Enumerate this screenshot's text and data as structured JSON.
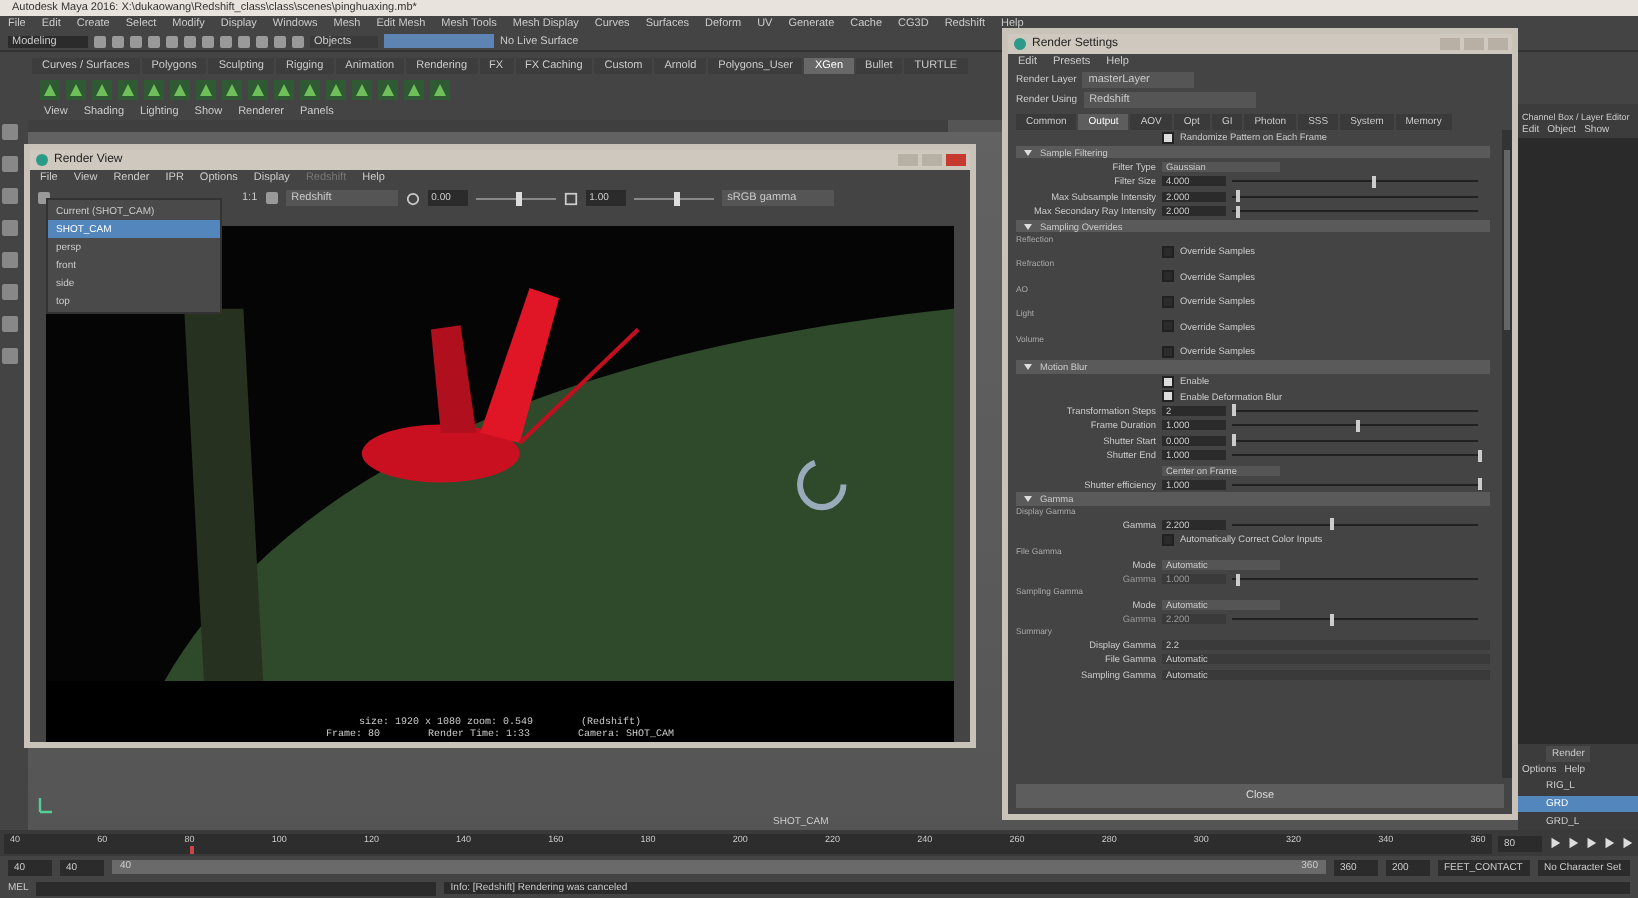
{
  "app": {
    "title": "Autodesk Maya 2016: X:\\dukaowang\\Redshift_class\\class\\scenes\\pinghuaxing.mb*"
  },
  "main_menu": [
    "File",
    "Edit",
    "Create",
    "Select",
    "Modify",
    "Display",
    "Windows",
    "Mesh",
    "Edit Mesh",
    "Mesh Tools",
    "Mesh Display",
    "Curves",
    "Surfaces",
    "Deform",
    "UV",
    "Generate",
    "Cache",
    "CG3D",
    "Redshift",
    "Help"
  ],
  "status_line": {
    "mode": "Modeling",
    "selection": "Objects",
    "live_surface": "No Live Surface"
  },
  "shelf": {
    "tabs": [
      {
        "label": "Curves / Surfaces",
        "selected": false
      },
      {
        "label": "Polygons",
        "selected": false
      },
      {
        "label": "Sculpting",
        "selected": false
      },
      {
        "label": "Rigging",
        "selected": false
      },
      {
        "label": "Animation",
        "selected": false
      },
      {
        "label": "Rendering",
        "selected": false
      },
      {
        "label": "FX",
        "selected": false
      },
      {
        "label": "FX Caching",
        "selected": false
      },
      {
        "label": "Custom",
        "selected": false
      },
      {
        "label": "Arnold",
        "selected": false
      },
      {
        "label": "Polygons_User",
        "selected": false
      },
      {
        "label": "XGen",
        "selected": true
      },
      {
        "label": "Bullet",
        "selected": false
      },
      {
        "label": "TURTLE",
        "selected": false
      }
    ]
  },
  "panel_menu": [
    "View",
    "Shading",
    "Lighting",
    "Show",
    "Renderer",
    "Panels"
  ],
  "viewport": {
    "camera_label": "SHOT_CAM"
  },
  "render_view": {
    "title": "Render View",
    "menu": [
      {
        "label": "File",
        "disabled": false
      },
      {
        "label": "View",
        "disabled": false
      },
      {
        "label": "Render",
        "disabled": false
      },
      {
        "label": "IPR",
        "disabled": false
      },
      {
        "label": "Options",
        "disabled": false
      },
      {
        "label": "Display",
        "disabled": false
      },
      {
        "label": "Redshift",
        "disabled": true
      },
      {
        "label": "Help",
        "disabled": false
      }
    ],
    "ratio": "1:1",
    "renderer": "Redshift",
    "exposure": "0.00",
    "exposure_slider": {
      "level": 0.5
    },
    "gamma": "1.00",
    "gamma_slider": {
      "level": 0.5
    },
    "color_space": "sRGB gamma",
    "camera_menu": [
      {
        "label": "Current (SHOT_CAM)",
        "selected": false
      },
      {
        "label": "SHOT_CAM",
        "selected": true
      },
      {
        "label": "persp",
        "selected": false
      },
      {
        "label": "front",
        "selected": false
      },
      {
        "label": "side",
        "selected": false
      },
      {
        "label": "top",
        "selected": false
      }
    ],
    "info_top": [
      "size: 1920 x 1080 zoom: 0.549",
      "(Redshift)"
    ],
    "info_bottom": [
      "Frame: 80",
      "Render Time: 1:33",
      "Camera: SHOT_CAM"
    ]
  },
  "render_settings": {
    "title": "Render Settings",
    "menu": [
      "Edit",
      "Presets",
      "Help"
    ],
    "render_layer_label": "Render Layer",
    "render_layer": "masterLayer",
    "render_using_label": "Render Using",
    "render_using": "Redshift",
    "tabs": [
      {
        "label": "Common",
        "selected": false
      },
      {
        "label": "Output",
        "selected": true
      },
      {
        "label": "AOV",
        "selected": false
      },
      {
        "label": "Opt",
        "selected": false
      },
      {
        "label": "GI",
        "selected": false
      },
      {
        "label": "Photon",
        "selected": false
      },
      {
        "label": "SSS",
        "selected": false
      },
      {
        "label": "System",
        "selected": false
      },
      {
        "label": "Memory",
        "selected": false
      }
    ],
    "rows": [
      {
        "kind": "checkbox",
        "label": "Randomize Pattern on Each Frame",
        "checked": true
      },
      {
        "kind": "section",
        "label": "Sample Filtering",
        "expanded": true
      },
      {
        "kind": "select",
        "label": "Filter Type",
        "value": "Gaussian"
      },
      {
        "kind": "slider",
        "label": "Filter Size",
        "value": "4.000",
        "level": 0.57
      },
      {
        "kind": "slider",
        "label": "Max Subsample Intensity",
        "value": "2.000",
        "level": 0.02
      },
      {
        "kind": "slider",
        "label": "Max Secondary Ray Intensity",
        "value": "2.000",
        "level": 0.02
      },
      {
        "kind": "section",
        "label": "Sampling Overrides",
        "expanded": true
      },
      {
        "kind": "override",
        "label": "Reflection",
        "value": "Override Samples",
        "checked": false
      },
      {
        "kind": "override",
        "label": "Refraction",
        "value": "Override Samples",
        "checked": false
      },
      {
        "kind": "override",
        "label": "AO",
        "value": "Override Samples",
        "checked": false
      },
      {
        "kind": "override",
        "label": "Light",
        "value": "Override Samples",
        "checked": false
      },
      {
        "kind": "override",
        "label": "Volume",
        "value": "Override Samples",
        "checked": false
      },
      {
        "kind": "section",
        "label": "Motion Blur",
        "expanded": true
      },
      {
        "kind": "checkbox",
        "label": "Enable",
        "checked": true
      },
      {
        "kind": "checkbox",
        "label": "Enable Deformation Blur",
        "checked": true
      },
      {
        "kind": "slider",
        "label": "Transformation Steps",
        "value": "2",
        "level": 0.0
      },
      {
        "kind": "slider",
        "label": "Frame Duration",
        "value": "1.000",
        "level": 0.5
      },
      {
        "kind": "slider",
        "label": "Shutter Start",
        "value": "0.000",
        "level": 0.0
      },
      {
        "kind": "slider",
        "label": "Shutter End",
        "value": "1.000",
        "level": 1.0
      },
      {
        "kind": "select",
        "label": "",
        "value": "Center on Frame"
      },
      {
        "kind": "slider",
        "label": "Shutter efficiency",
        "value": "1.000",
        "level": 1.0
      },
      {
        "kind": "section",
        "label": "Gamma",
        "expanded": true
      },
      {
        "kind": "subheading",
        "label": "Display Gamma"
      },
      {
        "kind": "slider",
        "label": "Gamma",
        "value": "2.200",
        "level": 0.4
      },
      {
        "kind": "checkbox",
        "label": "Automatically Correct Color Inputs",
        "checked": false
      },
      {
        "kind": "subheading",
        "label": "File Gamma"
      },
      {
        "kind": "select",
        "label": "Mode",
        "value": "Automatic"
      },
      {
        "kind": "slider",
        "label": "Gamma",
        "value": "1.000",
        "level": 0.02,
        "disabled": true
      },
      {
        "kind": "subheading",
        "label": "Sampling Gamma"
      },
      {
        "kind": "select",
        "label": "Mode",
        "value": "Automatic"
      },
      {
        "kind": "slider",
        "label": "Gamma",
        "value": "2.200",
        "level": 0.4,
        "disabled": true
      },
      {
        "kind": "subheading",
        "label": "Summary"
      },
      {
        "kind": "text",
        "label": "Display Gamma",
        "value": "2.2"
      },
      {
        "kind": "text",
        "label": "File Gamma",
        "value": "Automatic"
      },
      {
        "kind": "text",
        "label": "Sampling Gamma",
        "value": "Automatic"
      }
    ],
    "close": "Close"
  },
  "channel_box": {
    "title": "Channel Box / Layer Editor",
    "menu": [
      "Edit",
      "Object",
      "Show"
    ]
  },
  "layer_editor": {
    "tab": "Render",
    "menu": [
      "Options",
      "Help"
    ],
    "layers": [
      {
        "label": "RIG_L",
        "selected": false
      },
      {
        "label": "GRD",
        "selected": true
      },
      {
        "label": "GRD_L",
        "selected": false
      }
    ]
  },
  "timeline": {
    "ticks": [
      "40",
      "60",
      "80",
      "100",
      "120",
      "140",
      "160",
      "180",
      "200",
      "220",
      "240",
      "260",
      "280",
      "300",
      "320",
      "340",
      "360"
    ],
    "current_frame": "80",
    "playhead": {
      "level": 0.125
    }
  },
  "range": {
    "start": "40",
    "playback_start": "40",
    "slider": {
      "start": "40",
      "end": "360"
    },
    "playback_end": "360",
    "end": "200",
    "anim_layer": "FEET_CONTACT",
    "character_set": "No Character Set"
  },
  "command_line": {
    "language": "MEL",
    "feedback": "Info: [Redshift] Rendering was canceled"
  }
}
